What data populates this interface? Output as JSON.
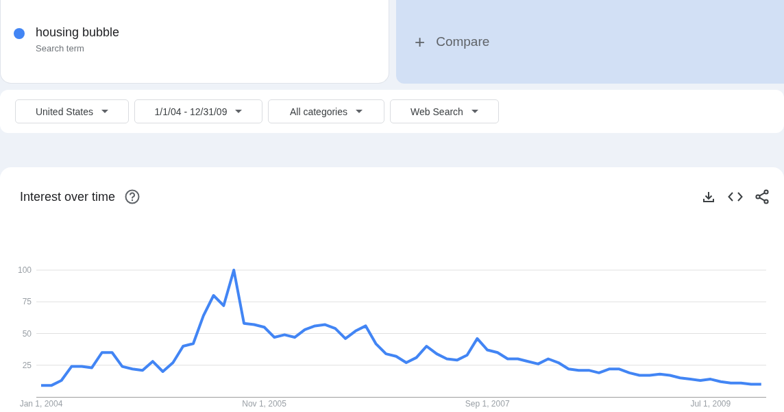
{
  "search_term": {
    "term": "housing bubble",
    "caption": "Search term",
    "color": "#4285f4"
  },
  "compare": {
    "label": "Compare",
    "icon": "+"
  },
  "filters": [
    {
      "label": "United States"
    },
    {
      "label": "1/1/04 - 12/31/09"
    },
    {
      "label": "All categories"
    },
    {
      "label": "Web Search"
    }
  ],
  "interest_over_time": {
    "title": "Interest over time",
    "chart_data": {
      "type": "line",
      "ylim": [
        0,
        100
      ],
      "yticks": [
        25,
        50,
        75,
        100
      ],
      "grid": true,
      "categories": [
        "Jan 1, 2004",
        null,
        null,
        null,
        null,
        null,
        null,
        null,
        null,
        null,
        null,
        null,
        null,
        null,
        null,
        null,
        null,
        null,
        null,
        null,
        null,
        null,
        "Nov 1, 2005",
        null,
        null,
        null,
        null,
        null,
        null,
        null,
        null,
        null,
        null,
        null,
        null,
        null,
        null,
        null,
        null,
        null,
        null,
        null,
        null,
        null,
        "Sep 1, 2007",
        null,
        null,
        null,
        null,
        null,
        null,
        null,
        null,
        null,
        null,
        null,
        null,
        null,
        null,
        null,
        null,
        null,
        null,
        null,
        null,
        null,
        "Jul 1, 2009",
        null,
        null,
        null,
        null,
        null
      ],
      "series": [
        {
          "color": "#4285f4",
          "values": [
            9,
            9,
            13,
            24,
            24,
            23,
            35,
            35,
            24,
            22,
            21,
            28,
            20,
            27,
            40,
            42,
            64,
            80,
            72,
            100,
            58,
            57,
            55,
            47,
            49,
            47,
            53,
            56,
            57,
            54,
            46,
            52,
            56,
            42,
            34,
            32,
            27,
            31,
            40,
            34,
            30,
            29,
            33,
            46,
            37,
            35,
            30,
            30,
            28,
            26,
            30,
            27,
            22,
            21,
            21,
            19,
            22,
            22,
            19,
            17,
            17,
            18,
            17,
            15,
            14,
            13,
            14,
            12,
            11,
            11,
            10,
            10
          ]
        }
      ]
    }
  }
}
